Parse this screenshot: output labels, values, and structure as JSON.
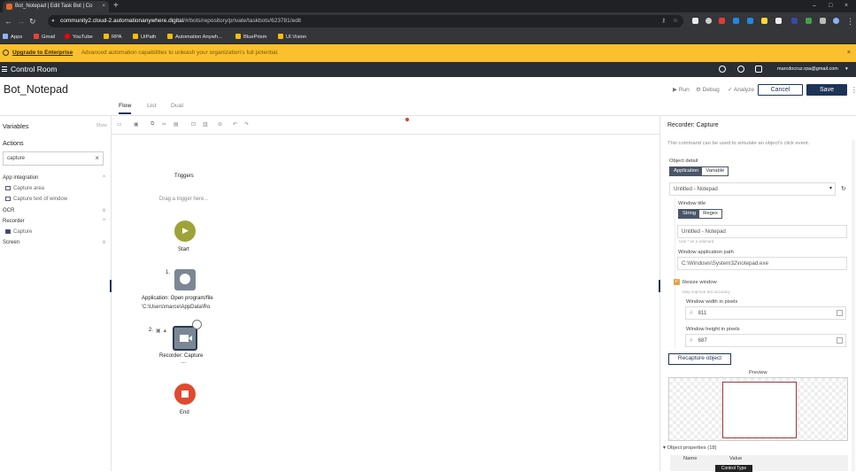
{
  "browser": {
    "tab_title": "Bot_Notepad | Edit Task Bot | Co",
    "tab_close": "×",
    "new_tab": "+",
    "window_controls": [
      "–",
      "□",
      "×"
    ],
    "url_host": "community2.cloud-2.automationanywhere.digital",
    "url_path": "/#/bots/repository/private/taskbots/623781/edit",
    "bookmarks": [
      {
        "label": "Apps",
        "color": "#8ab4f8"
      },
      {
        "label": "Gmail",
        "color": "#ea4335"
      },
      {
        "label": "YouTube",
        "color": "#ff0000"
      },
      {
        "label": "RPA",
        "color": "#fbbc04"
      },
      {
        "label": "UiPath",
        "color": "#fbbc04"
      },
      {
        "label": "Automation Anywh...",
        "color": "#fbbc04"
      },
      {
        "label": "BluePrism",
        "color": "#fbbc04"
      },
      {
        "label": "UI.Vision",
        "color": "#fbbc04"
      }
    ]
  },
  "banner": {
    "link": "Upgrade to Enterprise",
    "text": "Advanced automation capabilities to unleash your organization's full potential.",
    "close": "×"
  },
  "app": {
    "title": "Control Room",
    "user": "marcdocruz.rpa@gmail.com"
  },
  "bot": {
    "name": "Bot_Notepad",
    "run": "Run",
    "debug": "Debug",
    "analyze": "Analyze",
    "cancel": "Cancel",
    "save": "Save"
  },
  "tabs": [
    "Flow",
    "List",
    "Dual"
  ],
  "sidebar": {
    "variables": "Variables",
    "show": "Show",
    "actions": "Actions",
    "search_value": "capture",
    "groups": [
      {
        "label": "App integration",
        "items": [
          "Capture area",
          "Capture text of window"
        ],
        "chev": "^"
      },
      {
        "label": "OCR",
        "items": [],
        "chev": "v"
      },
      {
        "label": "Recorder",
        "items": [
          "Capture"
        ],
        "chev": "^"
      },
      {
        "label": "Screen",
        "items": [],
        "chev": "v"
      }
    ]
  },
  "flow": {
    "triggers": "Triggers",
    "drag": "Drag a trigger here...",
    "start": "Start",
    "step1_num": "1.",
    "step1_title": "Application: Open program/file",
    "step1_sub": "'C:\\Users\\marce\\AppData\\Ro",
    "step2_num": "2.",
    "step2_title": "Recorder: Capture",
    "step2_sub": "...",
    "end": "End"
  },
  "panel": {
    "title": "Recorder: Capture",
    "desc": "This command can be used to simulate an object's click event.",
    "object_detail": "Object detail",
    "seg1": [
      "Application",
      "Variable"
    ],
    "window_select": "Untitled - Notepad",
    "window_title": "Window title",
    "seg2": [
      "String",
      "Regex"
    ],
    "title_value": "Untitled - Notepad",
    "wildcard_hint": "Use * as a wildcard",
    "app_path_label": "Window application path",
    "app_path": "C:\\Windows\\System32\\notepad.exe",
    "resize": "Resize window",
    "resize_hint": "May improve bot accuracy",
    "width_label": "Window width in pixels",
    "width": "811",
    "height_label": "Window height in pixels",
    "height": "687",
    "recapture": "Recapture object",
    "preview": "Preview",
    "object_props": "Object properties (18)",
    "col_name": "Name",
    "col_value": "Value",
    "tooltip": "Control Type"
  }
}
